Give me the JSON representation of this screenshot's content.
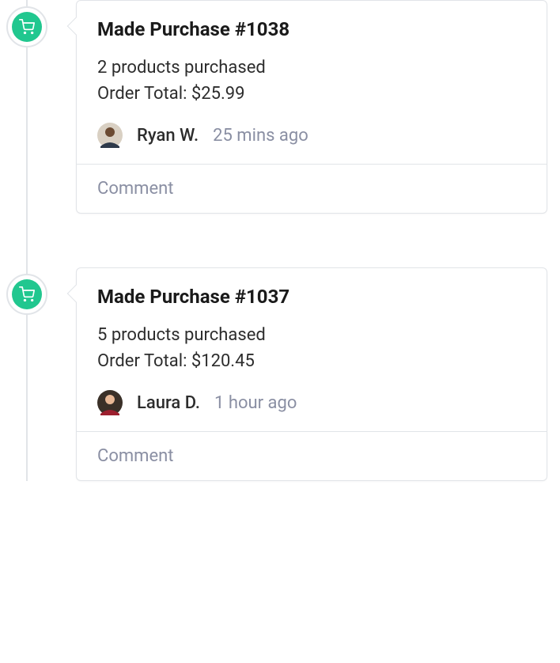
{
  "timeline": {
    "items": [
      {
        "icon": "cart",
        "title": "Made Purchase #1038",
        "products_line": "2 products purchased",
        "total_line": "Order Total: $25.99",
        "author": "Ryan W.",
        "timestamp": "25 mins ago",
        "comment_label": "Comment",
        "avatar_colors": {
          "bg": "#d9d0c3",
          "face": "#6b4a32",
          "shirt": "#2e3a4a"
        }
      },
      {
        "icon": "cart",
        "title": "Made Purchase #1037",
        "products_line": "5 products purchased",
        "total_line": "Order Total: $120.45",
        "author": "Laura D.",
        "timestamp": "1 hour ago",
        "comment_label": "Comment",
        "avatar_colors": {
          "bg": "#3a3028",
          "face": "#e8b896",
          "shirt": "#9c1f2e"
        }
      }
    ]
  }
}
